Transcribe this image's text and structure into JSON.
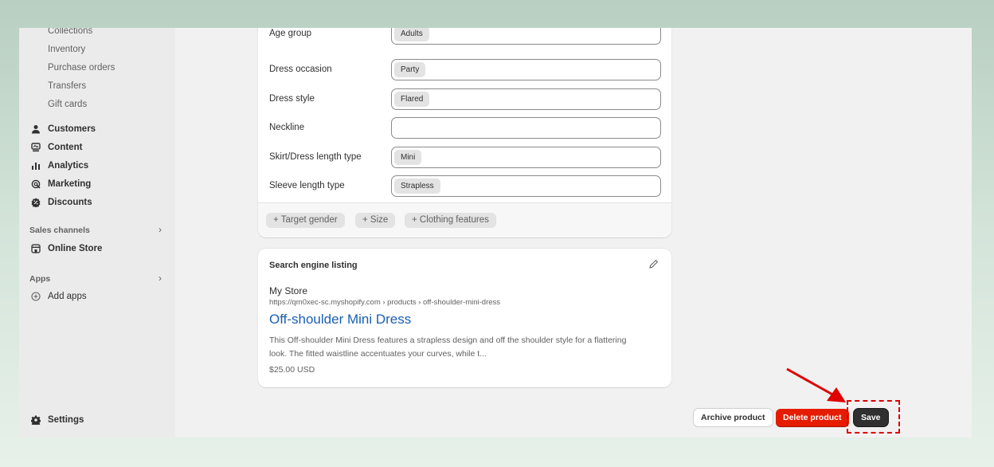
{
  "sidebar": {
    "sub_items": [
      "Collections",
      "Inventory",
      "Purchase orders",
      "Transfers",
      "Gift cards"
    ],
    "items": [
      {
        "label": "Customers",
        "icon": "person-icon"
      },
      {
        "label": "Content",
        "icon": "content-icon"
      },
      {
        "label": "Analytics",
        "icon": "bar-chart-icon"
      },
      {
        "label": "Marketing",
        "icon": "target-icon"
      },
      {
        "label": "Discounts",
        "icon": "discount-icon"
      }
    ],
    "sales_channels_label": "Sales channels",
    "online_store_label": "Online Store",
    "apps_label": "Apps",
    "add_apps_label": "Add apps",
    "settings_label": "Settings"
  },
  "attributes": {
    "rows": [
      {
        "label": "Age group",
        "value": "Adults"
      },
      {
        "label": "Dress occasion",
        "value": "Party"
      },
      {
        "label": "Dress style",
        "value": "Flared"
      },
      {
        "label": "Neckline",
        "value": ""
      },
      {
        "label": "Skirt/Dress length type",
        "value": "Mini"
      },
      {
        "label": "Sleeve length type",
        "value": "Strapless"
      }
    ],
    "add_buttons": [
      "+ Target gender",
      "+ Size",
      "+ Clothing features"
    ]
  },
  "seo": {
    "title": "Search engine listing",
    "store": "My Store",
    "url": "https://qm0xec-sc.myshopify.com › products › off-shoulder-mini-dress",
    "product_title": "Off-shoulder Mini Dress",
    "description": "This Off-shoulder Mini Dress features a strapless design and off the shoulder style for a flattering look. The fitted waistline accentuates your curves, while t...",
    "price": "$25.00 USD"
  },
  "actions": {
    "archive_label": "Archive product",
    "delete_label": "Delete product",
    "save_label": "Save"
  },
  "colors": {
    "accent_red": "#e51c00",
    "annotation_red": "#e00000",
    "link_blue": "#1a5fb4"
  }
}
